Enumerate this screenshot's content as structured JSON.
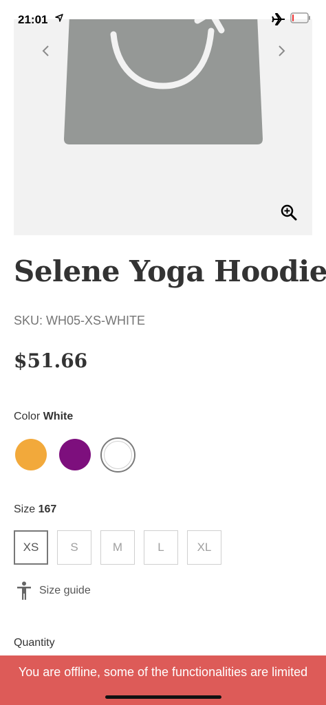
{
  "status_bar": {
    "time": "21:01",
    "icons": [
      "location-arrow-icon",
      "airplane-icon",
      "battery-low-icon"
    ],
    "battery_level": 0.1
  },
  "gallery": {
    "image_icon": "shopping-bag-placeholder",
    "controls": [
      "chevron-left-icon",
      "chevron-right-icon",
      "zoom-in-icon"
    ]
  },
  "product": {
    "title": "Selene Yoga Hoodie",
    "sku": "SKU: WH05-XS-WHITE",
    "price": "$51.66"
  },
  "color": {
    "label": "Color",
    "selected": "White",
    "options": [
      {
        "name": "orange",
        "hex": "#f2a93b"
      },
      {
        "name": "purple",
        "hex": "#7d0f7d"
      },
      {
        "name": "white",
        "hex": "#ffffff"
      }
    ]
  },
  "size": {
    "label": "Size",
    "selected": "167",
    "options": [
      "XS",
      "S",
      "M",
      "L",
      "XL"
    ],
    "selected_option": "XS"
  },
  "size_guide": {
    "label": "Size guide",
    "icon": "person-icon"
  },
  "quantity": {
    "label": "Quantity"
  },
  "offline_banner": {
    "text": "You are offline, some of the functionalities are limited",
    "color": "#dd5b58"
  }
}
